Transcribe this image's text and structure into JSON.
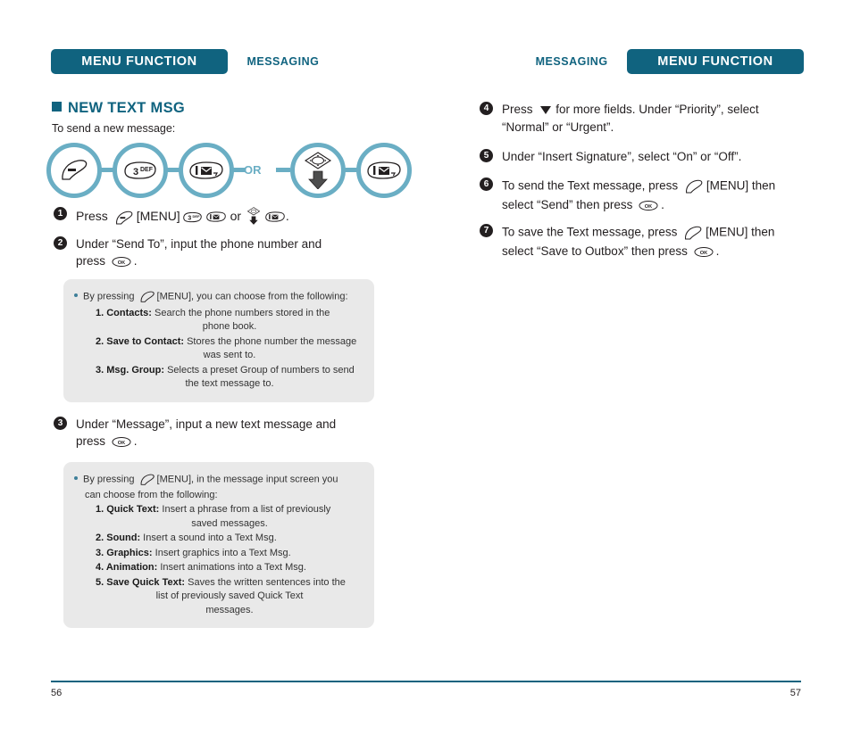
{
  "header": {
    "left": {
      "pill_label": "MENU FUNCTION",
      "section_label": "MESSAGING"
    },
    "right": {
      "pill_label": "MENU FUNCTION",
      "section_label": "MESSAGING"
    }
  },
  "heading": {
    "title": "NEW TEXT MSG",
    "subtitle": "To send a new message:"
  },
  "diagram": {
    "or_label": "OR",
    "keys": [
      {
        "name": "send-menu-key",
        "label": ""
      },
      {
        "name": "key-3-def",
        "label": "3",
        "sub": "DEF"
      },
      {
        "name": "key-1-message",
        "label": "1"
      },
      {
        "name": "nav-pad-down-key",
        "label": ""
      },
      {
        "name": "key-1-message",
        "label": "1"
      }
    ]
  },
  "steps_left": [
    {
      "num": "1",
      "text_parts": [
        "Press",
        "[MENU]",
        "or",
        "."
      ]
    },
    {
      "num": "2",
      "line1": "Under “Send To”, input the phone number and",
      "line2_pre": "press",
      "line2_post": "."
    },
    {
      "num": "3",
      "line1": "Under “Message”, input a new text message and",
      "line2_pre": "press",
      "line2_post": "."
    }
  ],
  "note1": {
    "intro_pre": "By pressing",
    "intro_post": "[MENU], you can choose from the following:",
    "items": [
      {
        "idx": "1. Contacts:",
        "body": "Search the phone numbers stored in the",
        "body2": "phone book."
      },
      {
        "idx": "2. Save to Contact:",
        "body": "Stores the phone number the message",
        "body2": "was sent to."
      },
      {
        "idx": "3. Msg. Group:",
        "body": "Selects a preset Group of numbers to send",
        "body2": "the text message to."
      }
    ]
  },
  "note2": {
    "intro_pre": "By pressing",
    "intro_post": "[MENU], in the message input screen you",
    "intro_line2": "can choose from the following:",
    "items": [
      {
        "idx": "1. Quick Text:",
        "body": "Insert a phrase from a list of previously",
        "body2": "saved messages."
      },
      {
        "idx": "2. Sound:",
        "body": "Insert a sound into a Text Msg.",
        "body2": ""
      },
      {
        "idx": "3. Graphics:",
        "body": "Insert graphics into a Text Msg.",
        "body2": ""
      },
      {
        "idx": "4. Animation:",
        "body": "Insert animations into a Text Msg.",
        "body2": ""
      },
      {
        "idx": "5. Save Quick Text:",
        "body": "Saves the written sentences into the",
        "body2": "list of previously saved Quick Text",
        "body3": "messages."
      }
    ]
  },
  "steps_right": [
    {
      "num": "4",
      "line1_pre": "Press",
      "line1_post": "for more fields.  Under “Priority”, select",
      "line2": "“Normal” or “Urgent”."
    },
    {
      "num": "5",
      "line1": "Under “Insert Signature”, select “On” or “Off”."
    },
    {
      "num": "6",
      "line1_pre": "To send the Text message, press",
      "line1_post": "[MENU] then",
      "line2_pre": "select “Send” then press",
      "line2_post": "."
    },
    {
      "num": "7",
      "line1_pre": "To save the Text message, press",
      "line1_post": "[MENU] then",
      "line2_pre": "select “Save to Outbox” then press",
      "line2_post": "."
    }
  ],
  "footer": {
    "page_left": "56",
    "page_right": "57"
  },
  "colors": {
    "teal_dark": "#10637f",
    "teal_light": "#6aaec4",
    "note_bg": "#e9e9e9",
    "text": "#231f20"
  }
}
